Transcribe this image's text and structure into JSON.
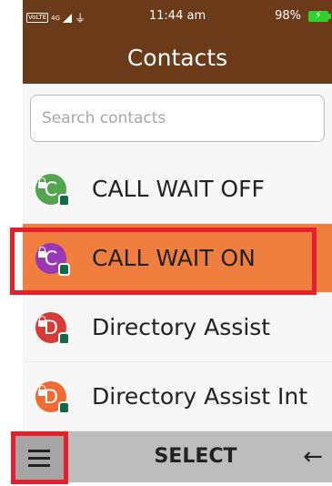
{
  "status_bar": {
    "network_label": "VoLTE",
    "network_type": "4G",
    "usb_icon": "usb-icon",
    "time": "11:44 am",
    "battery_level": "98%",
    "battery_color": "#2fd12f"
  },
  "header": {
    "title": "Contacts",
    "background": "#6b3a19"
  },
  "search": {
    "placeholder": "Search contacts",
    "value": ""
  },
  "contacts": [
    {
      "initial": "C",
      "name": "CALL WAIT OFF",
      "avatar_color": "#52a54d",
      "selected": false
    },
    {
      "initial": "C",
      "name": "CALL WAIT ON",
      "avatar_color": "#9a37b5",
      "selected": true
    },
    {
      "initial": "D",
      "name": "Directory Assist",
      "avatar_color": "#d83a35",
      "selected": false
    },
    {
      "initial": "D",
      "name": "Directory Assist Int",
      "avatar_color": "#f06a32",
      "selected": false
    }
  ],
  "colors": {
    "selected_row": "#ef7e3f",
    "annotation_box": "#e5202a",
    "softkey_bar": "#bdbdbd"
  },
  "softkeys": {
    "left_icon": "hamburger-menu-icon",
    "center_label": "SELECT",
    "right_icon": "back-arrow-icon",
    "right_glyph": "←"
  }
}
